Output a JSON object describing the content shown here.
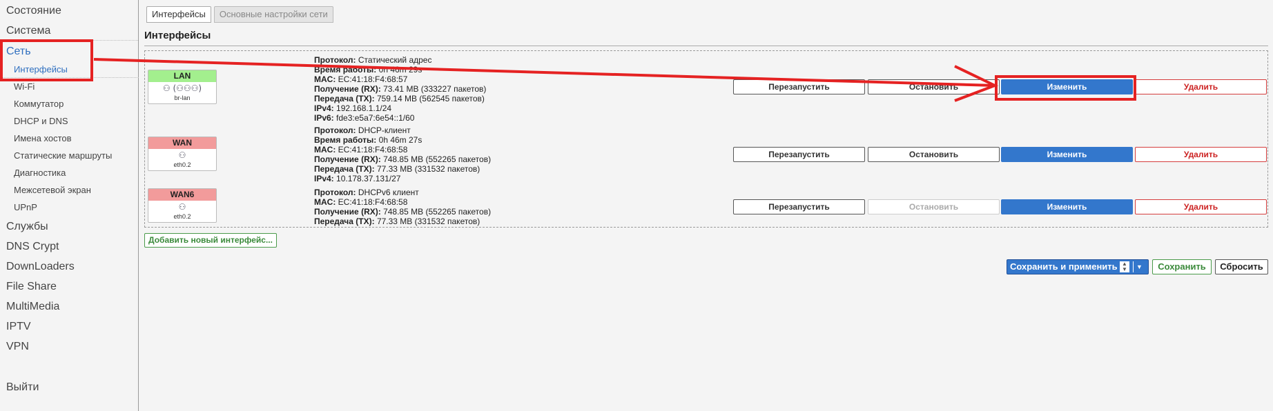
{
  "sidebar": {
    "top_items": [
      "Состояние",
      "Система"
    ],
    "active_item": "Сеть",
    "sub_items": [
      "Интерфейсы",
      "Wi-Fi",
      "Коммутатор",
      "DHCP и DNS",
      "Имена хостов",
      "Статические маршруты",
      "Диагностика",
      "Межсетевой экран",
      "UPnP"
    ],
    "bottom_items": [
      "Службы",
      "DNS Crypt",
      "DownLoaders",
      "File Share",
      "MultiMedia",
      "IPTV",
      "VPN"
    ],
    "logout": "Выйти"
  },
  "tabs": [
    "Интерфейсы",
    "Основные настройки сети"
  ],
  "section_title": "Интерфейсы",
  "interfaces": [
    {
      "name": "LAN",
      "status": "up",
      "icons": "⚇ (⚇⚇⚇)",
      "device": "br-lan",
      "info": [
        {
          "k": "Протокол:",
          "v": "Статический адрес"
        },
        {
          "k": "Время работы:",
          "v": "0h 46m 29s"
        },
        {
          "k": "MAC:",
          "v": "EC:41:18:F4:68:57"
        },
        {
          "k": "Получение (RX):",
          "v": "73.41 MB (333227 пакетов)"
        },
        {
          "k": "Передача (TX):",
          "v": "759.14 MB (562545 пакетов)"
        },
        {
          "k": "IPv4:",
          "v": "192.168.1.1/24"
        },
        {
          "k": "IPv6:",
          "v": "fde3:e5a7:6e54::1/60"
        }
      ]
    },
    {
      "name": "WAN",
      "status": "down",
      "icons": "⚇",
      "device": "eth0.2",
      "info": [
        {
          "k": "Протокол:",
          "v": "DHCP-клиент"
        },
        {
          "k": "Время работы:",
          "v": "0h 46m 27s"
        },
        {
          "k": "MAC:",
          "v": "EC:41:18:F4:68:58"
        },
        {
          "k": "Получение (RX):",
          "v": "748.85 MB (552265 пакетов)"
        },
        {
          "k": "Передача (TX):",
          "v": "77.33 MB (331532 пакетов)"
        },
        {
          "k": "IPv4:",
          "v": "10.178.37.131/27"
        }
      ]
    },
    {
      "name": "WAN6",
      "status": "down",
      "icons": "⚇",
      "device": "eth0.2",
      "info": [
        {
          "k": "Протокол:",
          "v": "DHCPv6 клиент"
        },
        {
          "k": "MAC:",
          "v": "EC:41:18:F4:68:58"
        },
        {
          "k": "Получение (RX):",
          "v": "748.85 MB (552265 пакетов)"
        },
        {
          "k": "Передача (TX):",
          "v": "77.33 MB (331532 пакетов)"
        }
      ]
    }
  ],
  "row_buttons": {
    "restart": "Перезапустить",
    "stop": "Остановить",
    "edit": "Изменить",
    "delete": "Удалить"
  },
  "add_interface": "Добавить новый интерфейс...",
  "footer": {
    "save_apply": "Сохранить и применить",
    "save": "Сохранить",
    "reset": "Сбросить"
  },
  "colors": {
    "accent": "#3377cc",
    "link": "#2f6fbf",
    "status_up": "#a3ef8e",
    "status_down": "#f29b9b",
    "danger": "#cc2222",
    "annotation": "#e52222"
  }
}
